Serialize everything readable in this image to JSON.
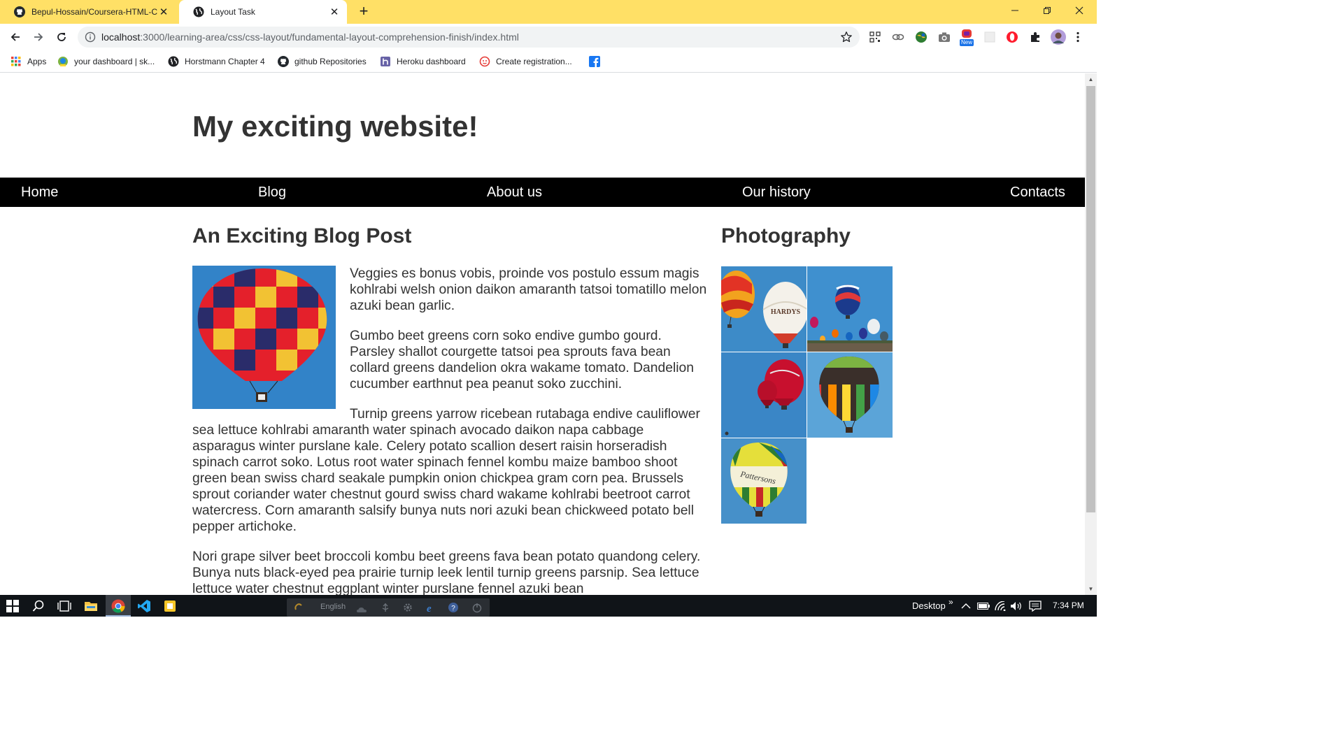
{
  "browser": {
    "tabs": [
      {
        "title": "Bepul-Hossain/Coursera-HTML-C",
        "icon": "github-icon",
        "active": false
      },
      {
        "title": "Layout Task",
        "icon": "globe-icon",
        "active": true
      }
    ],
    "url": {
      "host": "localhost",
      "path": ":3000/learning-area/css/css-layout/fundamental-layout-comprehension-finish/index.html"
    },
    "accent_color": "#ffe066",
    "bookmarks": [
      {
        "label": "Apps",
        "icon": "apps-grid-icon"
      },
      {
        "label": "your dashboard | sk...",
        "icon": "dashboard-icon"
      },
      {
        "label": "Horstmann Chapter 4",
        "icon": "globe-icon"
      },
      {
        "label": "github Repositories",
        "icon": "github-icon"
      },
      {
        "label": "Heroku dashboard",
        "icon": "heroku-icon"
      },
      {
        "label": "Create registration...",
        "icon": "registration-icon"
      },
      {
        "label": "",
        "icon": "facebook-icon"
      }
    ],
    "extension_badge": "New"
  },
  "page": {
    "site_title": "My exciting website!",
    "nav": [
      "Home",
      "Blog",
      "About us",
      "Our history",
      "Contacts"
    ],
    "post_heading": "An Exciting Blog Post",
    "paragraphs": [
      "Veggies es bonus vobis, proinde vos postulo essum magis kohlrabi welsh onion daikon amaranth tatsoi tomatillo melon azuki bean garlic.",
      "Gumbo beet greens corn soko endive gumbo gourd. Parsley shallot courgette tatsoi pea sprouts fava bean collard greens dandelion okra wakame tomato. Dandelion cucumber earthnut pea peanut soko zucchini.",
      "Turnip greens yarrow ricebean rutabaga endive cauliflower sea lettuce kohlrabi amaranth water spinach avocado daikon napa cabbage asparagus winter purslane kale. Celery potato scallion desert raisin horseradish spinach carrot soko. Lotus root water spinach fennel kombu maize bamboo shoot green bean swiss chard seakale pumpkin onion chickpea gram corn pea. Brussels sprout coriander water chestnut gourd swiss chard wakame kohlrabi beetroot carrot watercress. Corn amaranth salsify bunya nuts nori azuki bean chickweed potato bell pepper artichoke.",
      "Nori grape silver beet broccoli kombu beet greens fava bean potato quandong celery. Bunya nuts black-eyed pea prairie turnip leek lentil turnip greens parsnip. Sea lettuce lettuce water chestnut eggplant winter purslane fennel azuki bean"
    ],
    "photo_heading": "Photography",
    "photo_captions": {
      "hardys": "HARDYS",
      "pattersons": "Pattersons"
    },
    "nav_bar_color": "#000000"
  },
  "taskbar": {
    "language": "English",
    "desktop_label": "Desktop",
    "time": "7:34 PM"
  }
}
